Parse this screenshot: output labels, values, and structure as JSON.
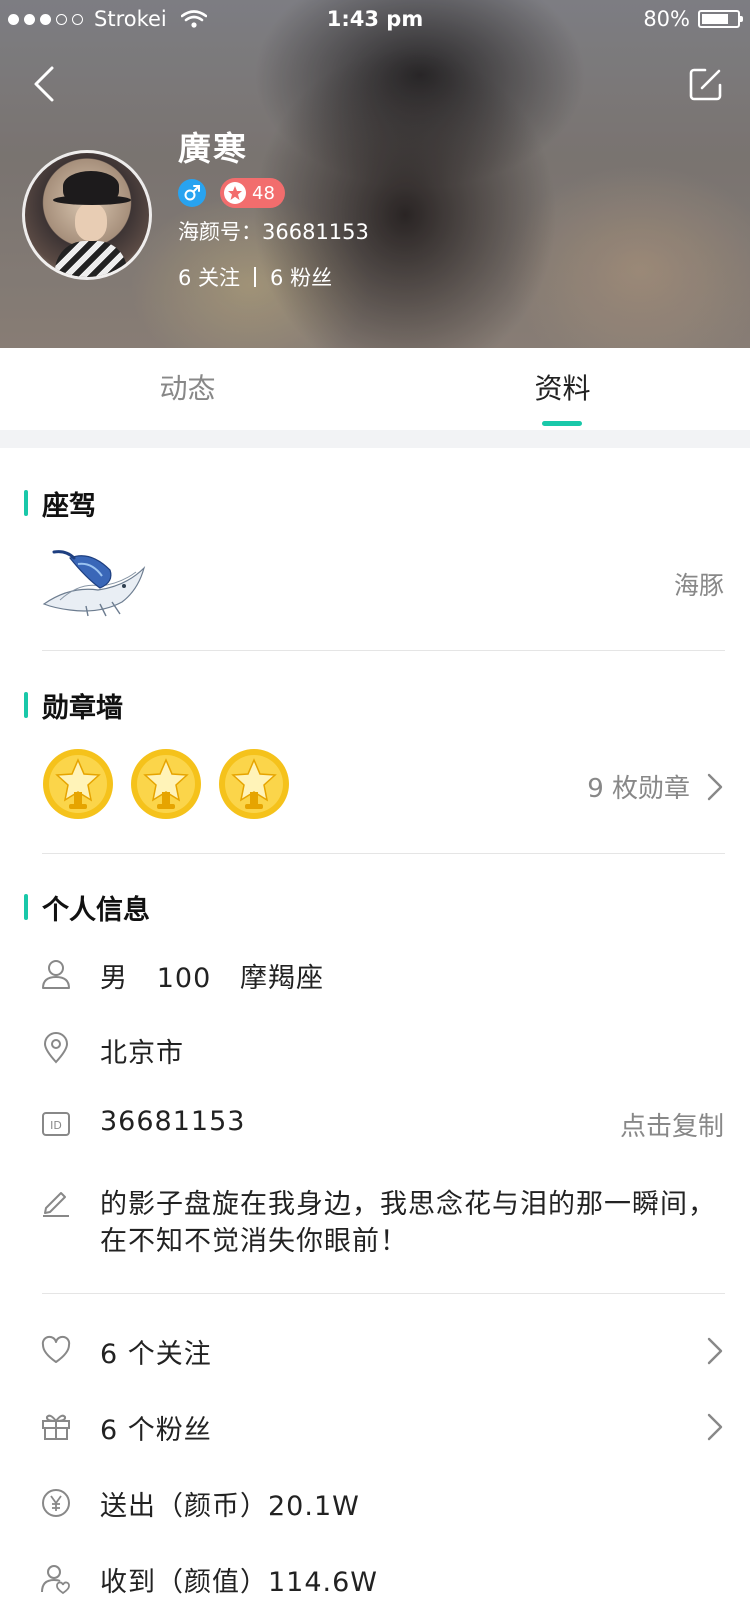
{
  "status_bar": {
    "carrier": "Strokei",
    "time": "1:43 pm",
    "battery": "80%",
    "battery_level": 0.8
  },
  "header": {
    "back_icon": "chevron-left-icon",
    "edit_icon": "edit-icon"
  },
  "profile": {
    "name": "廣寒",
    "gender_icon": "male-icon",
    "level": "48",
    "id_line": "海颜号：36681153",
    "following": "6 关注",
    "followers": "6 粉丝"
  },
  "tabs": [
    {
      "label": "动态",
      "active": false
    },
    {
      "label": "资料",
      "active": true
    }
  ],
  "vehicle_section": {
    "title": "座驾",
    "vehicle_icon": "whale-vehicle-icon",
    "vehicle_name": "海豚"
  },
  "medal_section": {
    "title": "勋章墙",
    "medal_icon": "gold-star-medal-icon",
    "medal_count_label": "9 枚勋章"
  },
  "personal_section": {
    "title": "个人信息",
    "basic_info": "男   100   摩羯座",
    "location": "北京市",
    "id_number": "36681153",
    "copy_label": "点击复制",
    "bio": "的影子盘旋在我身边，我思念花与泪的那一瞬间，在不知不觉消失你眼前！"
  },
  "stats_list": [
    {
      "icon": "heart-icon",
      "label": "6 个关注"
    },
    {
      "icon": "gift-icon",
      "label": "6 个粉丝"
    },
    {
      "icon": "yen-coin-icon",
      "label": "送出（颜币）20.1W"
    },
    {
      "icon": "user-heart-icon",
      "label": "收到（颜值）114.6W"
    }
  ],
  "colors": {
    "accent": "#19c8a9",
    "male_badge": "#28a3f0",
    "level_badge": "#f26d6d",
    "medal_gold": "#f5c21b"
  }
}
